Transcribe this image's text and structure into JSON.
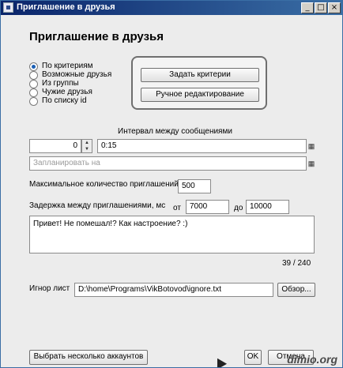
{
  "window": {
    "title": "Приглашение в друзья",
    "minimize": "_",
    "maximize": "□",
    "close": "×"
  },
  "heading": "Приглашение в друзья",
  "source_options": [
    {
      "label": "По критериям",
      "selected": true
    },
    {
      "label": "Возможные друзья",
      "selected": false
    },
    {
      "label": "Из группы",
      "selected": false
    },
    {
      "label": "Чужие друзья",
      "selected": false
    },
    {
      "label": "По списку id",
      "selected": false
    }
  ],
  "buttons": {
    "set_criteria": "Задать критерии",
    "manual_edit": "Ручное редактирование",
    "browse": "Обзор...",
    "select_accounts": "Выбрать несколько аккаунтов",
    "ok": "OK",
    "cancel": "Отмена"
  },
  "interval": {
    "label": "Интервал между сообщениями",
    "count": "0",
    "time": "0:15",
    "schedule_placeholder": "Запланировать на"
  },
  "max_invites": {
    "label": "Максимальное количество приглашений",
    "value": "500"
  },
  "delay": {
    "label": "Задержка между приглашениями, мс",
    "from_label": "от",
    "from_value": "7000",
    "to_label": "до",
    "to_value": "10000"
  },
  "message": {
    "text": "Привет! Не помешал!? Как настроение? :)",
    "counter": "39 / 240"
  },
  "ignore": {
    "label": "Игнор лист",
    "path": "D:\\home\\Programs\\VikBotovod\\ignore.txt"
  },
  "watermark": "dimio.org",
  "icons": {
    "calendar": "calendar-icon",
    "spin_up": "arrow-up-icon",
    "spin_down": "arrow-down-icon"
  }
}
